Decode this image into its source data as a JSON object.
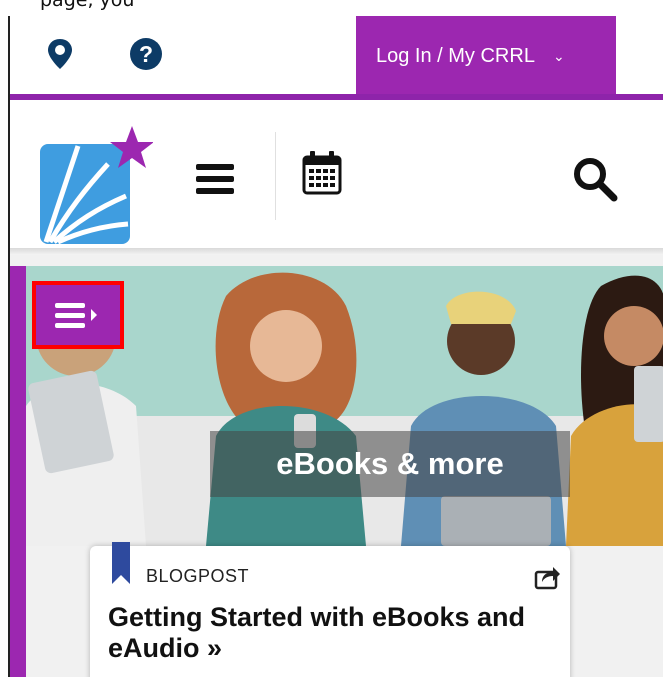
{
  "caption_text": "page, you",
  "header": {
    "login_label": "Log In / My CRRL",
    "login_chevron": "⌄",
    "icons": [
      "location-pin-icon",
      "help-circle-icon",
      "hamburger-menu-icon",
      "calendar-icon",
      "search-icon"
    ]
  },
  "hero": {
    "label": "eBooks & more",
    "menu_icon": "sidebar-menu-toggle-icon"
  },
  "card": {
    "type": "BLOGPOST",
    "title": "Getting Started with eBooks and eAudio »"
  },
  "colors": {
    "brand_purple": "#9c27b0",
    "logo_blue": "#3f9de0",
    "logo_star": "#9c27b0",
    "highlight_red": "#ff0000",
    "bookmark_navy": "#2e4a9e"
  }
}
